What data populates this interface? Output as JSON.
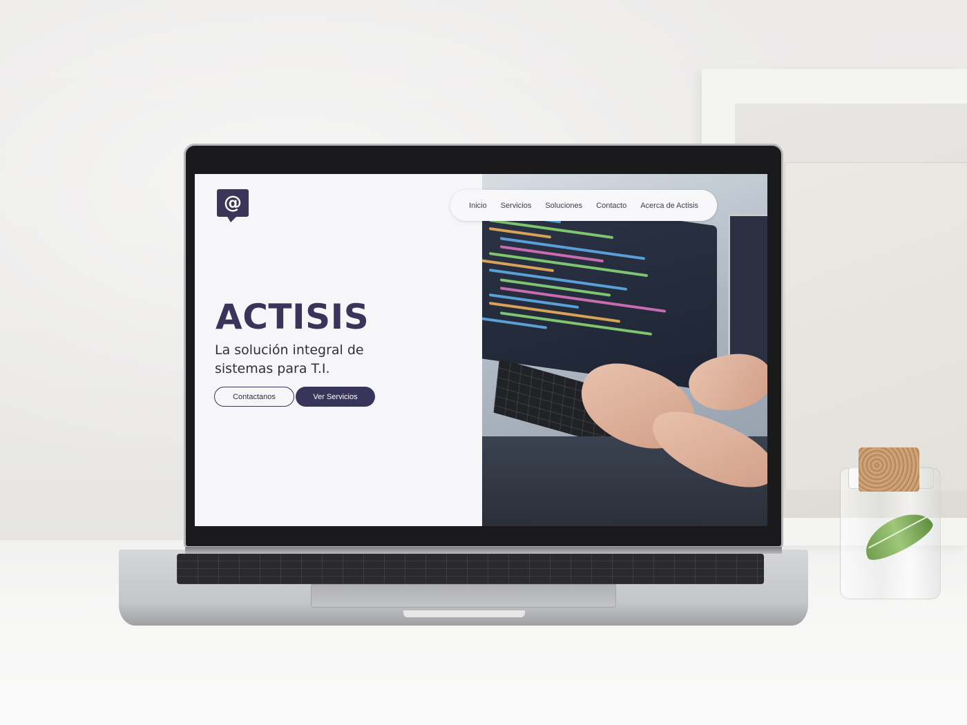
{
  "site": {
    "logo_glyph": "@",
    "nav": {
      "items": [
        {
          "label": "Inicio"
        },
        {
          "label": "Servicios"
        },
        {
          "label": "Soluciones"
        },
        {
          "label": "Contacto"
        },
        {
          "label": "Acerca de Actisis"
        }
      ]
    },
    "hero": {
      "title": "ACTISIS",
      "subtitle": "La solución integral de sistemas para T.I.",
      "primary_button": "Contactanos",
      "secondary_button": "Ver Servicios"
    },
    "colors": {
      "brand": "#38345a",
      "background": "#f6f6f8"
    }
  }
}
